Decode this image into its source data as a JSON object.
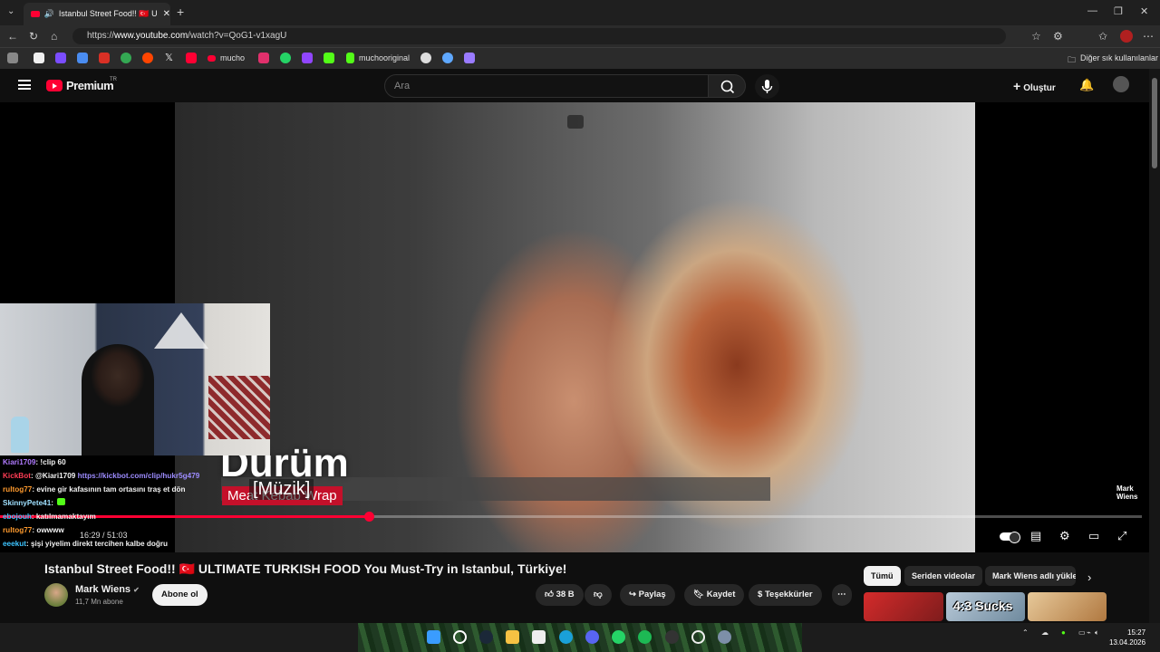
{
  "browser": {
    "tab_title": "Istanbul Street Food!! 🇹🇷 ULTIMATE",
    "url_prefix": "https://",
    "url_host": "www.youtube.com",
    "url_path": "/watch?v=QoG1-v1xagU",
    "bookmarks": [
      "mucho",
      "muchooriginal"
    ],
    "bookmarks_folder": "Diğer sık kullanılanlar"
  },
  "youtube": {
    "logo_text": "Premium",
    "logo_region": "TR",
    "search_placeholder": "Ara",
    "create_label": "Oluştur"
  },
  "video": {
    "overlay_title": "Dürüm",
    "overlay_subtitle": "Meat Kebab Wrap",
    "caption": "[Müzik]",
    "watermark": "Mark\nWiens",
    "current_time": "16:29",
    "duration": "51:03",
    "time_display": "16:29 / 51:03",
    "progress_fraction": 0.323
  },
  "chat": [
    {
      "user": "Kiari1709",
      "msg": ": !clip 60",
      "cls": "u1"
    },
    {
      "user": "KickBot",
      "msg": ": @Kiari1709 ",
      "link": "https://kickbot.com/clip/hukr5g479",
      "cls": "u2"
    },
    {
      "user": "rultog77",
      "msg": ": evine gir kafasının tam ortasını traş et dön",
      "cls": "u3"
    },
    {
      "user": "SkinnyPete41",
      "msg": ":",
      "cls": "u4"
    },
    {
      "user": "ebojouh",
      "msg": ": katılmamaktayım",
      "cls": "u5"
    },
    {
      "user": "rultog77",
      "msg": ": owwww",
      "cls": "u3"
    },
    {
      "user": "eeekut",
      "msg": ": şişi yiyelim direkt tercihen kalbe doğru",
      "cls": "u5"
    }
  ],
  "info": {
    "title": "Istanbul Street Food!! 🇹🇷 ULTIMATE TURKISH FOOD You Must-Try in Istanbul, Türkiye!",
    "channel": "Mark Wiens",
    "subscribers": "11,7 Mn abone",
    "subscribe_label": "Abone ol",
    "likes": "38 B",
    "share_label": "Paylaş",
    "save_label": "Kaydet",
    "thanks_label": "Teşekkürler"
  },
  "chips": [
    "Tümü",
    "Seriden videolar",
    "Mark Wiens adlı yükle"
  ],
  "thumb_text": "4:3 Sucks",
  "clock": {
    "time": "15:27",
    "date": "13.04.2026"
  },
  "colors": {
    "accent": "#ff0033",
    "bg": "#0f0f0f",
    "chip": "#272727"
  }
}
